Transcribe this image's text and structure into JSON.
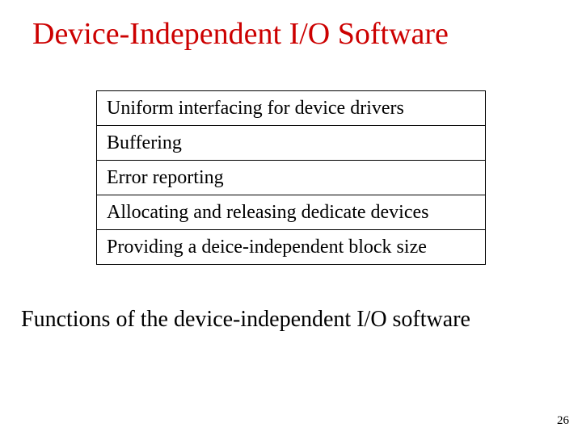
{
  "title": "Device-Independent I/O Software",
  "rows": [
    "Uniform interfacing for device drivers",
    "Buffering",
    "Error reporting",
    "Allocating and releasing dedicate devices",
    "Providing a deice-independent block size"
  ],
  "caption": "Functions of the device-independent I/O software",
  "page_number": "26"
}
